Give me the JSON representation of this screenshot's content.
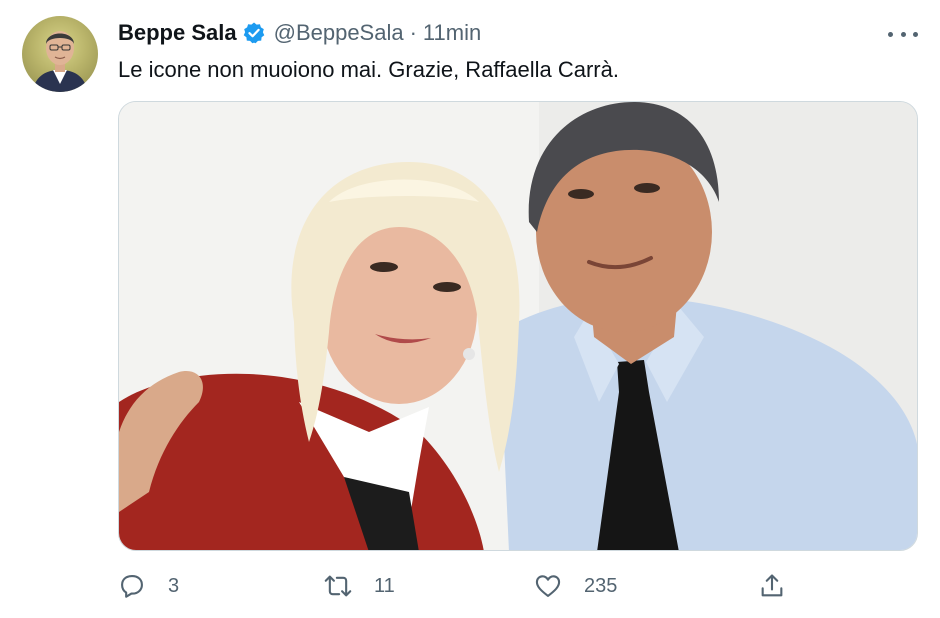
{
  "author": {
    "name": "Beppe Sala",
    "handle": "@BeppeSala",
    "separator": "·",
    "time": "11min",
    "verified": true
  },
  "tweet": {
    "text": "Le icone non muoiono mai. Grazie, Raffaella Carrà."
  },
  "actions": {
    "reply": {
      "icon": "reply-icon",
      "count": "3"
    },
    "retweet": {
      "icon": "retweet-icon",
      "count": "11"
    },
    "like": {
      "icon": "heart-icon",
      "count": "235"
    },
    "share": {
      "icon": "share-icon"
    }
  },
  "colors": {
    "text": "#0f1419",
    "secondary": "#536471",
    "verified_badge": "#1d9bf0",
    "border": "#cfd9de"
  }
}
